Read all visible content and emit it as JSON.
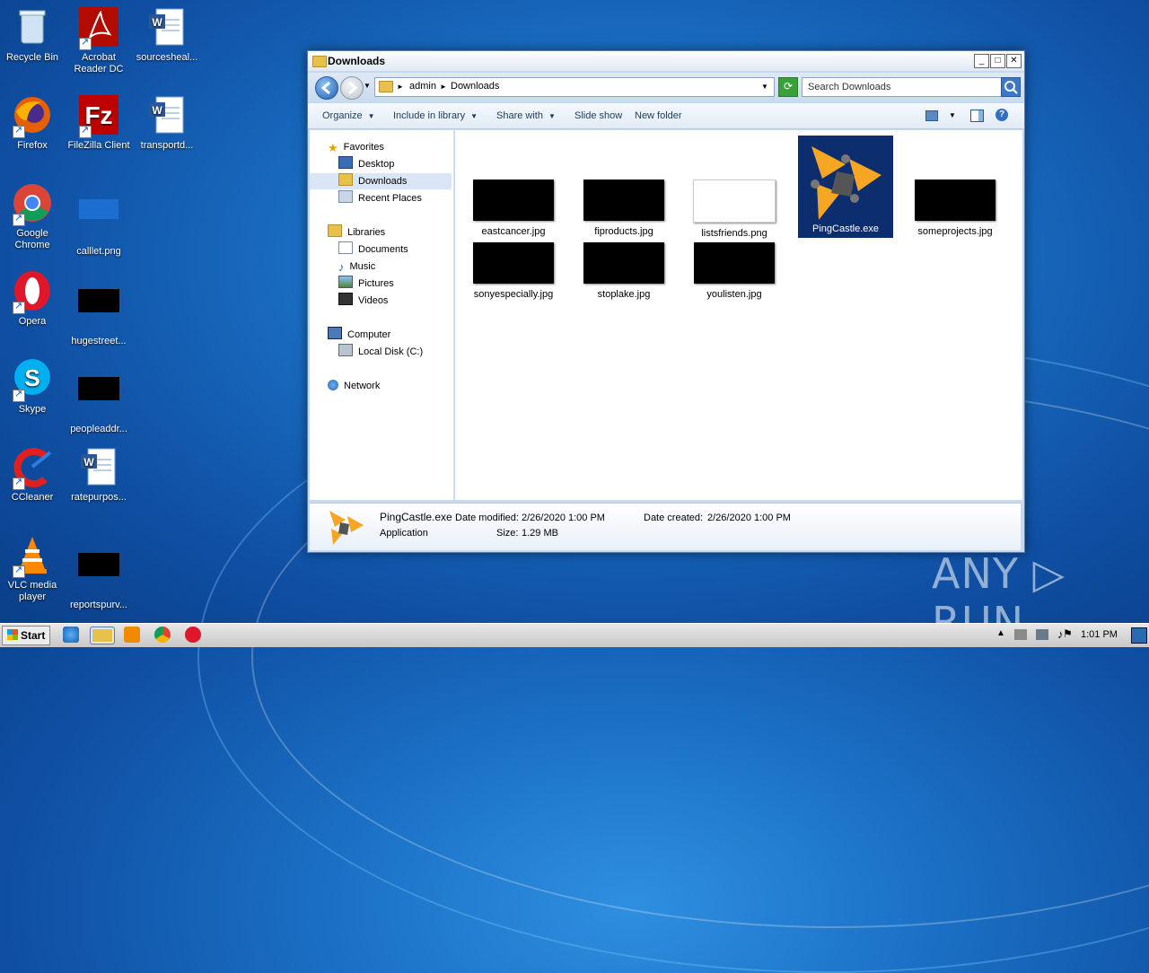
{
  "desktop": {
    "icons": [
      {
        "label": "Recycle Bin"
      },
      {
        "label": "Acrobat Reader DC"
      },
      {
        "label": "sourcesheal..."
      },
      {
        "label": "Firefox"
      },
      {
        "label": "FileZilla Client"
      },
      {
        "label": "transportd..."
      },
      {
        "label": "Google Chrome"
      },
      {
        "label": "calllet.png"
      },
      {
        "label": "Opera"
      },
      {
        "label": "hugestreet..."
      },
      {
        "label": "Skype"
      },
      {
        "label": "peopleaddr..."
      },
      {
        "label": "CCleaner"
      },
      {
        "label": "ratepurpos..."
      },
      {
        "label": "VLC media player"
      },
      {
        "label": "reportspurv..."
      }
    ]
  },
  "window": {
    "title": "Downloads",
    "breadcrumb": [
      "admin",
      "Downloads"
    ],
    "search_placeholder": "Search Downloads",
    "toolbar": {
      "organize": "Organize",
      "include": "Include in library",
      "share": "Share with",
      "slideshow": "Slide show",
      "newfolder": "New folder"
    },
    "nav": {
      "favorites": "Favorites",
      "desktop": "Desktop",
      "downloads": "Downloads",
      "recent": "Recent Places",
      "libraries": "Libraries",
      "documents": "Documents",
      "music": "Music",
      "pictures": "Pictures",
      "videos": "Videos",
      "computer": "Computer",
      "localdisk": "Local Disk (C:)",
      "network": "Network"
    },
    "files": [
      {
        "name": "eastcancer.jpg"
      },
      {
        "name": "fiproducts.jpg"
      },
      {
        "name": "listsfriends.png"
      },
      {
        "name": "PingCastle.exe"
      },
      {
        "name": "someprojects.jpg"
      },
      {
        "name": "sonyespecially.jpg"
      },
      {
        "name": "stoplake.jpg"
      },
      {
        "name": "youlisten.jpg"
      }
    ],
    "details": {
      "name": "PingCastle.exe",
      "type": "Application",
      "modified_label": "Date modified:",
      "modified": "2/26/2020 1:00 PM",
      "created_label": "Date created:",
      "created": "2/26/2020 1:00 PM",
      "size_label": "Size:",
      "size": "1.29 MB"
    }
  },
  "taskbar": {
    "start": "Start",
    "clock": "1:01 PM"
  },
  "watermark": "ANY ▷ RUN",
  "colors": {
    "selection": "#0d2e6e",
    "accent": "#f5a623"
  }
}
